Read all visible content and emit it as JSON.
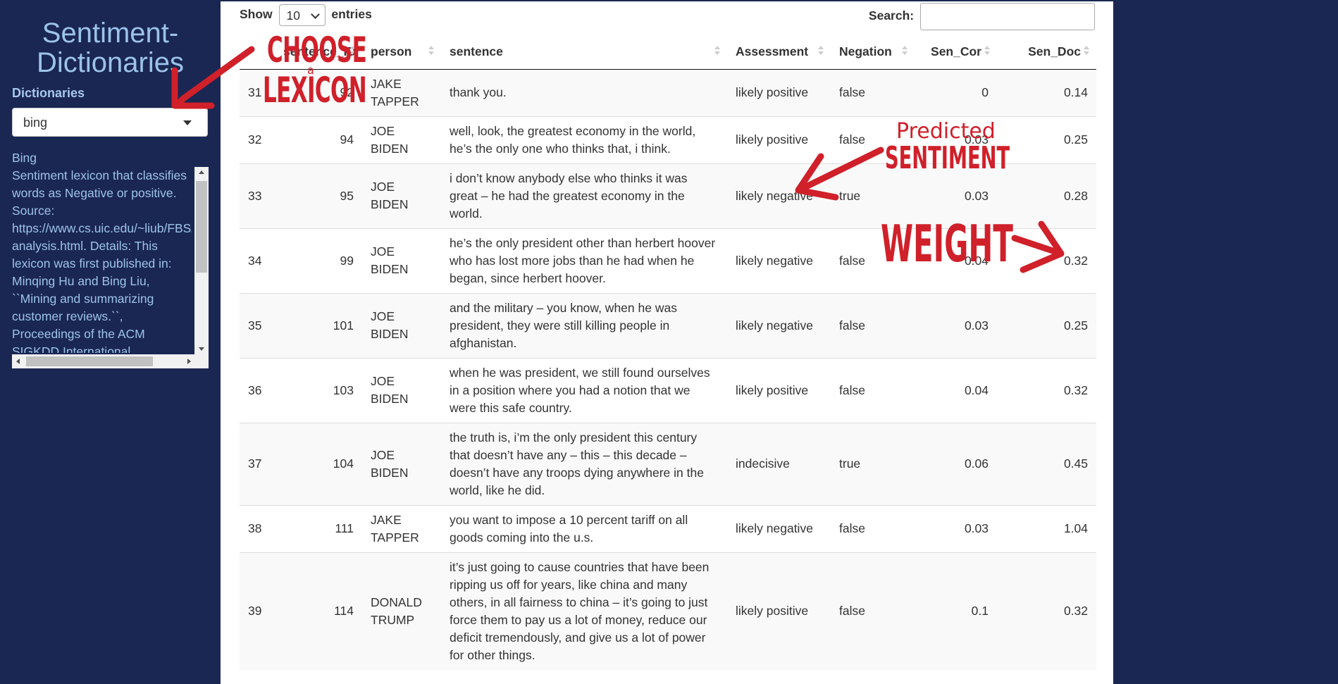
{
  "sidebar": {
    "title": "Sentiment-\nDictionaries",
    "dictionaries_label": "Dictionaries",
    "selected_dictionary": "bing",
    "description_title": "Bing",
    "description_text": "Sentiment lexicon that classifies\nwords as Negative or positive.\nSource:\nhttps://www.cs.uic.edu/~liub/FBS/sentiment-\nanalysis.html. Details: This\nlexicon was first published in:\nMinqing Hu and Bing Liu,\n``Mining and summarizing\ncustomer reviews.``,\nProceedings of the ACM\nSIGKDD International"
  },
  "table_controls": {
    "show_label": "Show",
    "entries_value": "10",
    "entries_label": "entries",
    "search_label": "Search:"
  },
  "table": {
    "columns": [
      "sentence_ID",
      "person",
      "sentence",
      "Assessment",
      "Negation",
      "Sen_Cor",
      "Sen_Doc"
    ],
    "rows": [
      {
        "idx": "31",
        "sid": "92",
        "person": "JAKE TAPPER",
        "sentence": "thank you.",
        "assessment": "likely positive",
        "negation": "false",
        "cor": "0",
        "doc": "0.14"
      },
      {
        "idx": "32",
        "sid": "94",
        "person": "JOE BIDEN",
        "sentence": "well, look, the greatest economy in the world, he’s the only one who thinks that, i think.",
        "assessment": "likely positive",
        "negation": "false",
        "cor": "0.03",
        "doc": "0.25"
      },
      {
        "idx": "33",
        "sid": "95",
        "person": "JOE BIDEN",
        "sentence": "i don’t know anybody else who thinks it was great – he had the greatest economy in the world.",
        "assessment": "likely negative",
        "negation": "true",
        "cor": "0.03",
        "doc": "0.28"
      },
      {
        "idx": "34",
        "sid": "99",
        "person": "JOE BIDEN",
        "sentence": "he’s the only president other than herbert hoover who has lost more jobs than he had when he began, since herbert hoover.",
        "assessment": "likely negative",
        "negation": "false",
        "cor": "0.04",
        "doc": "0.32"
      },
      {
        "idx": "35",
        "sid": "101",
        "person": "JOE BIDEN",
        "sentence": "and the military – you know, when he was president, they were still killing people in afghanistan.",
        "assessment": "likely negative",
        "negation": "false",
        "cor": "0.03",
        "doc": "0.25"
      },
      {
        "idx": "36",
        "sid": "103",
        "person": "JOE BIDEN",
        "sentence": "when he was president, we still found ourselves in a position where you had a notion that we were this safe country.",
        "assessment": "likely positive",
        "negation": "false",
        "cor": "0.04",
        "doc": "0.32"
      },
      {
        "idx": "37",
        "sid": "104",
        "person": "JOE BIDEN",
        "sentence": "the truth is, i’m the only president this century that doesn’t have any – this – this decade – doesn’t have any troops dying anywhere in the world, like he did.",
        "assessment": "indecisive",
        "negation": "true",
        "cor": "0.06",
        "doc": "0.45"
      },
      {
        "idx": "38",
        "sid": "111",
        "person": "JAKE TAPPER",
        "sentence": "you want to impose a 10 percent tariff on all goods coming into the u.s.",
        "assessment": "likely negative",
        "negation": "false",
        "cor": "0.03",
        "doc": "1.04"
      },
      {
        "idx": "39",
        "sid": "114",
        "person": "DONALD TRUMP",
        "sentence": "it’s just going to cause countries that have been ripping us off for years, like china and many others, in all fairness to china – it’s going to just force them to pay us a lot of money, reduce our deficit tremendously, and give us a lot of power for other things.",
        "assessment": "likely positive",
        "negation": "false",
        "cor": "0.1",
        "doc": "0.32"
      }
    ]
  },
  "annotations": {
    "choose": "CHOOSE",
    "a": "a",
    "lexicon": "LEXICON",
    "predicted": "Predicted",
    "sentiment": "SENTIMENT",
    "weight": "WEIGHT",
    "color": "#d0202a"
  },
  "colors": {
    "sidebar_bg": "#1a2752",
    "sidebar_text": "#9cc3ea",
    "annotation_red": "#d0202a"
  }
}
